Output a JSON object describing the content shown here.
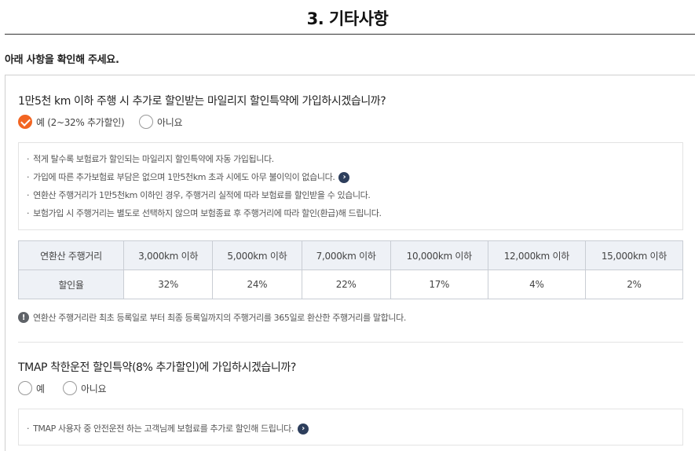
{
  "section": {
    "title": "3. 기타사항",
    "intro": "아래 사항을 확인해 주세요."
  },
  "mileage": {
    "question": "1만5천 km 이하 주행 시 추가로 할인받는 마일리지 할인특약에 가입하시겠습니까?",
    "options": [
      {
        "label": "예 (2~32% 추가할인)",
        "selected": true
      },
      {
        "label": "아니요",
        "selected": false
      }
    ],
    "bullets": [
      "적게 탈수록 보험료가 할인되는 마일리지 할인특약에 자동 가입됩니다.",
      "가입에 따른 추가보험료 부담은 없으며 1만5천km 초과 시에도 아무 불이익이 없습니다.",
      "연환산 주행거리가 1만5천km 이하인 경우, 주행거리 실적에 따라 보험료를 할인받을 수 있습니다.",
      "보험가입 시 주행거리는 별도로 선택하지 않으며 보험종료 후 주행거리에 따라 할인(환급)해 드립니다."
    ],
    "table": {
      "header_label": "연환산 주행거리",
      "row_label": "할인율",
      "columns": [
        "3,000km 이하",
        "5,000km 이하",
        "7,000km 이하",
        "10,000km 이하",
        "12,000km 이하",
        "15,000km 이하"
      ],
      "rates": [
        "32%",
        "24%",
        "22%",
        "17%",
        "4%",
        "2%"
      ]
    },
    "note": "연환산 주행거리란 최초 등록일로 부터 최종 등록일까지의 주행거리를 365일로 환산한 주행거리를 말합니다."
  },
  "tmap": {
    "question": "TMAP 착한운전 할인특약(8% 추가할인)에 가입하시겠습니까?",
    "options": [
      {
        "label": "예",
        "selected": false
      },
      {
        "label": "아니요",
        "selected": false
      }
    ],
    "bullets": [
      "TMAP 사용자 중 안전운전 하는 고객님께 보험료를 추가로 할인해 드립니다."
    ]
  },
  "colors": {
    "accent": "#f26522",
    "info_button": "#2d3e5c",
    "table_header_bg": "#eef1f6"
  },
  "icons": {
    "bullet_link": "chevron-right-icon",
    "note": "exclamation-circle-icon",
    "checked": "check-icon"
  }
}
